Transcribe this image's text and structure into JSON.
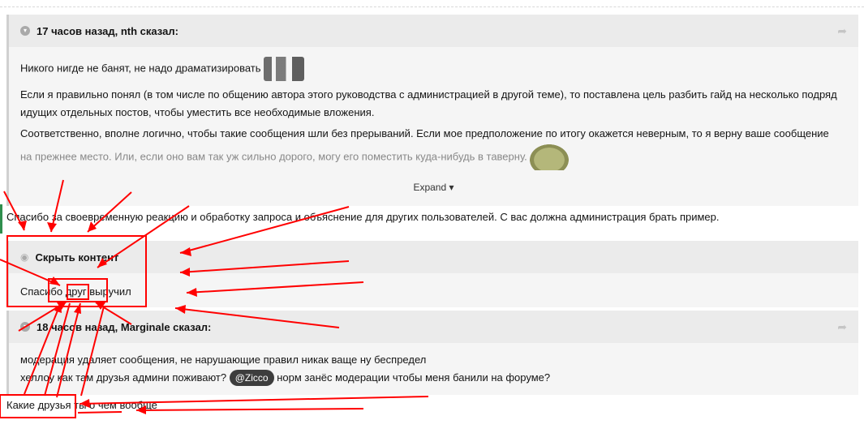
{
  "quote1": {
    "author_line": "17 часов назад, nth сказал:",
    "line1": "Никого нигде не банят, не надо драматизировать",
    "line2": "Если я правильно понял (в том числе по общению автора этого руководства с администрацией в другой теме), то поставлена цель разбить гайд на несколько подряд идущих отдельных постов, чтобы уместить все необходимые вложения.",
    "line3": "Соответственно, вполне логично, чтобы такие сообщения шли без прерываний. Если мое предположение по итогу окажется неверным, то я верну ваше сообщение",
    "line4": "на прежнее место. Или, если оно вам так уж сильно дорого, могу его поместить куда-нибудь в таверну.",
    "expand_label": "Expand"
  },
  "reply_text": "Спасибо за своевременную реакцию и обработку запроса и объяснение для других пользователей. С вас должна администрация брать пример.",
  "hidden_block": {
    "title": "Скрыть контент",
    "text": "Спасибо друг выручил"
  },
  "quote2": {
    "author_line": "18 часов назад, Marginale сказал:",
    "line1": "модерация удаляет сообщения, не нарушающие правил никак ваще ну беспредел",
    "line2_before": "хеллоу как там друзья админи поживают?",
    "mention": "@Zicco",
    "line2_after": "норм занёс модерации чтобы меня банили на форуме?"
  },
  "final_text": "Какие друзья ты о чем вообще",
  "icons": {
    "collapse": "chevron-down-circle-icon",
    "share": "share-arrow-icon",
    "hide": "eye-slash-icon"
  },
  "annotation_color": "#ff0000"
}
